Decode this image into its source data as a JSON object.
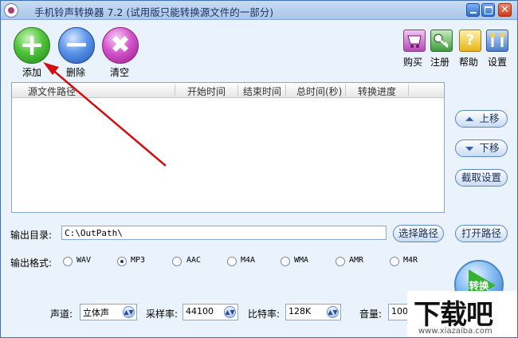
{
  "window": {
    "title": "手机铃声转换器 7.2 (试用版只能转换源文件的一部分)",
    "close_glyph": "✕"
  },
  "toolbar": {
    "add_label": "添加",
    "delete_label": "删除",
    "clear_label": "清空"
  },
  "top_right": {
    "buy_label": "购买",
    "register_label": "注册",
    "help_label": "帮助",
    "help_glyph": "?",
    "settings_label": "设置"
  },
  "file_list": {
    "columns": [
      "源文件路径",
      "开始时间",
      "结束时间",
      "总时间(秒)",
      "转换进度"
    ],
    "rows": []
  },
  "side": {
    "up_label": "上移",
    "down_label": "下移",
    "clip_label": "截取设置"
  },
  "output_dir": {
    "label": "输出目录:",
    "value": "C:\\OutPath\\",
    "choose_label": "选择路径",
    "open_label": "打开路径"
  },
  "format": {
    "label": "输出格式:",
    "options": [
      "WAV",
      "MP3",
      "AAC",
      "M4A",
      "WMA",
      "AMR",
      "M4R"
    ],
    "selected": "MP3"
  },
  "convert": {
    "label": "转换"
  },
  "audio": {
    "channel_label": "声道:",
    "channel_value": "立体声",
    "sample_label": "采样率:",
    "sample_value": "44100",
    "bitrate_label": "比特率:",
    "bitrate_value": "128K",
    "volume_label": "音量:",
    "volume_value": "100%"
  },
  "watermark": {
    "text": "下载吧",
    "url": "www.xiazaiba.com"
  },
  "colors": {
    "accent": "#3b6fb6",
    "annotation_arrow": "#d01010"
  }
}
